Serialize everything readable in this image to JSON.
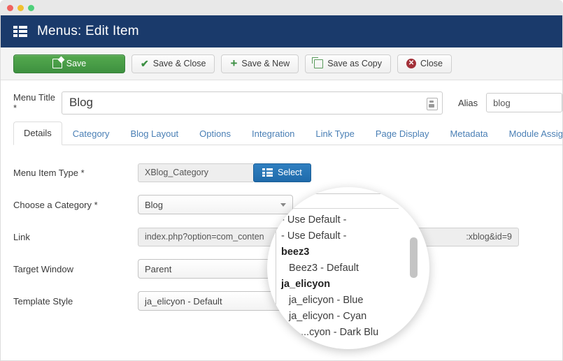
{
  "window": {
    "dots": [
      "close",
      "minimize",
      "maximize"
    ]
  },
  "header": {
    "icon": "list-grid-icon",
    "title": "Menus: Edit Item"
  },
  "toolbar": {
    "buttons": [
      {
        "label": "Save",
        "icon": "pencil-icon",
        "style": "primary-green"
      },
      {
        "label": "Save & Close",
        "icon": "check-icon",
        "style": "default"
      },
      {
        "label": "Save & New",
        "icon": "plus-icon",
        "style": "default"
      },
      {
        "label": "Save as Copy",
        "icon": "copy-icon",
        "style": "default"
      },
      {
        "label": "Close",
        "icon": "close-circle-icon",
        "style": "default"
      }
    ]
  },
  "title_row": {
    "menu_title_label": "Menu Title *",
    "menu_title_value": "Blog",
    "menu_title_badge_icon": "article-icon",
    "alias_label": "Alias",
    "alias_value": "blog"
  },
  "tabs": [
    {
      "label": "Details",
      "active": true
    },
    {
      "label": "Category",
      "active": false
    },
    {
      "label": "Blog Layout",
      "active": false
    },
    {
      "label": "Options",
      "active": false
    },
    {
      "label": "Integration",
      "active": false
    },
    {
      "label": "Link Type",
      "active": false
    },
    {
      "label": "Page Display",
      "active": false
    },
    {
      "label": "Metadata",
      "active": false
    },
    {
      "label": "Module Assignme",
      "active": false
    }
  ],
  "form": {
    "menu_item_type": {
      "label": "Menu Item Type *",
      "value": "XBlog_Category",
      "select_button_label": "Select",
      "select_button_icon": "grid-icon"
    },
    "choose_category": {
      "label": "Choose a Category *",
      "value": "Blog",
      "caret_icon": "chevron-down-icon"
    },
    "link": {
      "label": "Link",
      "value_left": "index.php?option=com_conten",
      "value_right": ":xblog&id=9"
    },
    "target_window": {
      "label": "Target Window",
      "value": "Parent"
    },
    "template_style": {
      "label": "Template Style",
      "value": "ja_elicyon - Default"
    }
  },
  "magnifier": {
    "options": [
      {
        "text": "- Use Default -",
        "type": "item"
      },
      {
        "text": "- Use Default -",
        "type": "item"
      },
      {
        "text": "beez3",
        "type": "group"
      },
      {
        "text": "Beez3 - Default",
        "type": "child"
      },
      {
        "text": "ja_elicyon",
        "type": "group"
      },
      {
        "text": "ja_elicyon - Blue",
        "type": "child"
      },
      {
        "text": "ja_elicyon - Cyan",
        "type": "child"
      },
      {
        "text": "...cyon - Dark Blu",
        "type": "child-clipped"
      }
    ]
  },
  "colors": {
    "header_blue": "#1a3a6b",
    "save_green": "#3e9140",
    "select_blue": "#1f6bab",
    "tab_link": "#4a7fb5",
    "close_red": "#a33139"
  }
}
